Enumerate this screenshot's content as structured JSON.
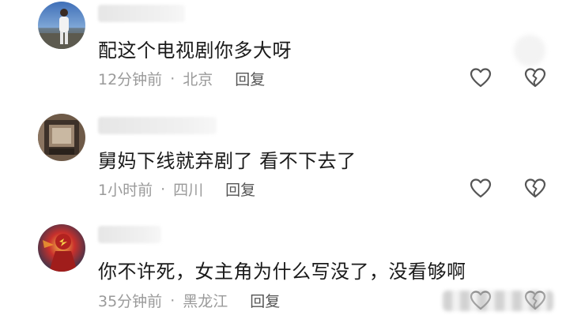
{
  "comments": [
    {
      "content": "配这个电视剧你多大呀",
      "time": "12分钟前",
      "separator": "·",
      "location": "北京",
      "reply_label": "回复"
    },
    {
      "content": "舅妈下线就弃剧了  看不下去了",
      "time": "1小时前",
      "separator": "·",
      "location": "四川",
      "reply_label": "回复"
    },
    {
      "content": "你不许死，女主角为什么写没了，没看够啊",
      "time": "35分钟前",
      "separator": "·",
      "location": "黑龙江",
      "reply_label": "回复"
    }
  ],
  "icons": {
    "like": "heart-outline-icon",
    "dislike": "broken-heart-icon"
  },
  "colors": {
    "text": "#1a1a1a",
    "meta": "#9a9a9a",
    "reply": "#555555",
    "icon": "#555555"
  }
}
